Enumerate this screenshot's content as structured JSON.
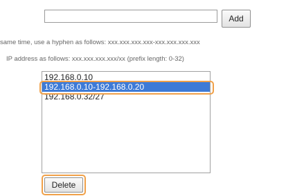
{
  "form": {
    "address_input_value": "",
    "add_label": "Add",
    "delete_label": "Delete"
  },
  "instructions": {
    "line1": "same time, use a hyphen as follows: xxx.xxx.xxx.xxx-xxx.xxx.xxx.xxx",
    "line2": "IP address as follows: xxx.xxx.xxx.xxx/xx (prefix length: 0-32)"
  },
  "address_list": {
    "items": [
      {
        "label": "192.168.0.10"
      },
      {
        "label": "192.168.0.10-192.168.0.20",
        "selected": true
      },
      {
        "label": "192.168.0.32/27"
      }
    ]
  },
  "colors": {
    "selection": "#3d7ad6",
    "highlight_outline": "#f0a048"
  }
}
